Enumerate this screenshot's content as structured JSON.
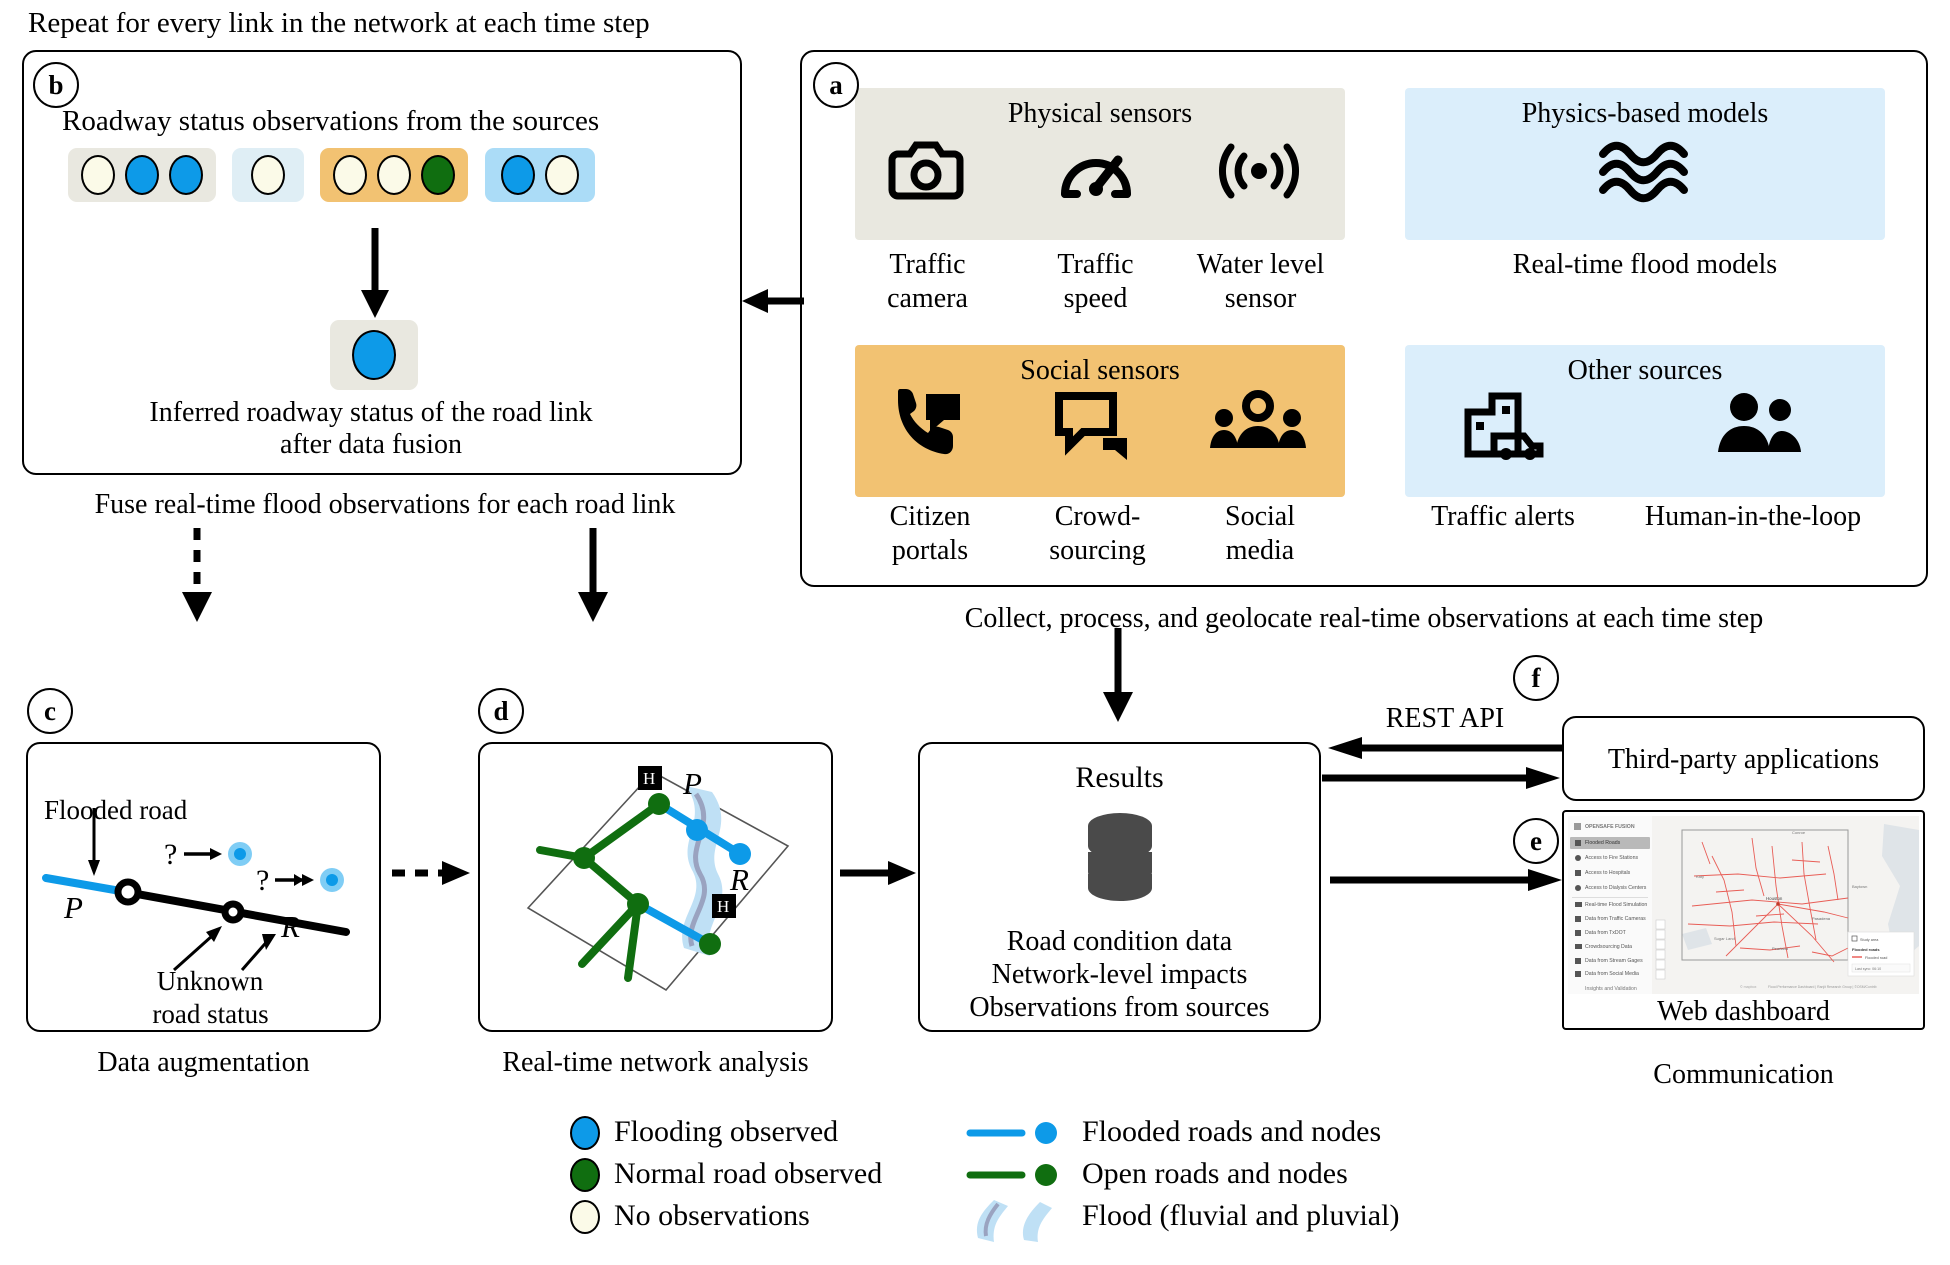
{
  "figure": {
    "top_caption": "Repeat for every link in the network at each time step",
    "caption_b_bottom": "Fuse real-time flood observations for each road link",
    "caption_a_bottom": "Collect, process, and geolocate real-time observations at each time step",
    "caption_c_bottom": "Data augmentation",
    "caption_d_bottom": "Real-time network analysis",
    "caption_f_bottom": "Communication",
    "rest_api_label": "REST API"
  },
  "panels": {
    "a": {
      "tag": "a"
    },
    "b": {
      "tag": "b"
    },
    "c": {
      "tag": "c"
    },
    "d": {
      "tag": "d"
    },
    "e": {
      "tag": "e"
    },
    "f": {
      "tag": "f"
    }
  },
  "panel_b": {
    "title": "Roadway status observations from the sources",
    "inferred_caption_line1": "Inferred roadway status of the road link",
    "inferred_caption_line2": "after data fusion",
    "source_groups": [
      {
        "name": "physical-sensors-group",
        "bg": "#e9e8e0",
        "observations": [
          "none",
          "flood",
          "flood"
        ]
      },
      {
        "name": "physics-models-group",
        "bg": "#dfeef5",
        "observations": [
          "none"
        ]
      },
      {
        "name": "social-sensors-group",
        "bg": "#f2c272",
        "observations": [
          "none",
          "none",
          "normal"
        ]
      },
      {
        "name": "other-sources-group",
        "bg": "#abdcf7",
        "observations": [
          "flood",
          "none"
        ]
      }
    ],
    "inferred_status": "flood",
    "inferred_bg": "#e9e8e0"
  },
  "panel_a": {
    "groups": [
      {
        "name": "physical-sensors",
        "title": "Physical sensors",
        "bg": "#e9e8e0",
        "items": [
          {
            "icon": "camera-icon",
            "label": "Traffic\ncamera",
            "label_l1": "Traffic",
            "label_l2": "camera"
          },
          {
            "icon": "speedometer-icon",
            "label": "Traffic\nspeed",
            "label_l1": "Traffic",
            "label_l2": "speed"
          },
          {
            "icon": "water-level-sensor-icon",
            "label": "Water level\nsensor",
            "label_l1": "Water level",
            "label_l2": "sensor"
          }
        ]
      },
      {
        "name": "physics-based-models",
        "title": "Physics-based models",
        "bg": "#dbeefb",
        "items": [
          {
            "icon": "waves-icon",
            "label": "Real-time flood models",
            "label_l1": "Real-time flood models",
            "label_l2": ""
          }
        ]
      },
      {
        "name": "social-sensors",
        "title": "Social sensors",
        "bg": "#f2c272",
        "items": [
          {
            "icon": "phone-call-icon",
            "label": "Citizen\nportals",
            "label_l1": "Citizen",
            "label_l2": "portals"
          },
          {
            "icon": "chat-bubbles-icon",
            "label": "Crowd-\nsourcing",
            "label_l1": "Crowd-",
            "label_l2": "sourcing"
          },
          {
            "icon": "social-media-people-icon",
            "label": "Social\nmedia",
            "label_l1": "Social",
            "label_l2": "media"
          }
        ]
      },
      {
        "name": "other-sources",
        "title": "Other sources",
        "bg": "#dbeefb",
        "items": [
          {
            "icon": "traffic-alert-icon",
            "label": "Traffic alerts",
            "label_l1": "Traffic alerts",
            "label_l2": ""
          },
          {
            "icon": "people-icon",
            "label": "Human-in-the-loop",
            "label_l1": "Human-in-the-loop",
            "label_l2": ""
          }
        ]
      }
    ]
  },
  "panel_c": {
    "flooded_road_label": "Flooded road",
    "unknown_line1": "Unknown",
    "unknown_line2": "road status",
    "node_p": "P",
    "node_r": "R",
    "question_1": "?",
    "question_2": "?"
  },
  "panel_d": {
    "node_p": "P",
    "node_r": "R",
    "hospital_marker": "H"
  },
  "results": {
    "title": "Results",
    "lines": [
      "Road condition data",
      "Network-level impacts",
      "Observations from sources"
    ],
    "db_color": "#4a4a4a"
  },
  "third_party": {
    "label": "Third-party applications"
  },
  "dashboard": {
    "caption": "Web dashboard",
    "brand": "OPENSAFE FUSION",
    "menu": [
      "Flooded Roads",
      "Access to Fire Stations",
      "Access to Hospitals",
      "Access to Dialysis Centers",
      "Real-time Flood Simulation",
      "Data from Traffic Cameras",
      "Data from TxDOT",
      "Crowdsourcing Data",
      "Data from Stream Gages",
      "Data from Social Media"
    ],
    "footer_menu": "Insights and Validation",
    "map_labels": [
      "Houston",
      "Pasadena",
      "Pearland",
      "Sugar Land",
      "Katy",
      "Conroe",
      "Baytown",
      "Galveston"
    ],
    "map_legend_title": "Flooded roads",
    "map_legend_sub": "Study area",
    "map_legend_item": "Flooded road",
    "map_legend_time": "Last sync: 06:10",
    "map_footer": "Flood Performance Dashboard  |  Ranjit Research Group  |  ©OSM/Contrib"
  },
  "legend": {
    "left_items": [
      {
        "marker": "flood",
        "label": "Flooding observed"
      },
      {
        "marker": "normal",
        "label": "Normal road observed"
      },
      {
        "marker": "none",
        "label": "No observations"
      }
    ],
    "right_items": [
      {
        "marker": "flooded-line-node",
        "label": "Flooded roads and nodes"
      },
      {
        "marker": "open-line-node",
        "label": "Open roads and nodes"
      },
      {
        "marker": "flood-polygon",
        "label": "Flood (fluvial and pluvial)"
      }
    ]
  },
  "colors": {
    "flood_blue": "#0d9ae8",
    "normal_green": "#106e10",
    "none_cream": "#fbfae8",
    "grey_bg": "#e9e8e0",
    "light_blue_bg": "#dbeefb",
    "orange_bg": "#f2c272",
    "sky_bg": "#abdcf7",
    "flood_poly": "#bfe0f5",
    "stream": "#9aa3c0"
  }
}
